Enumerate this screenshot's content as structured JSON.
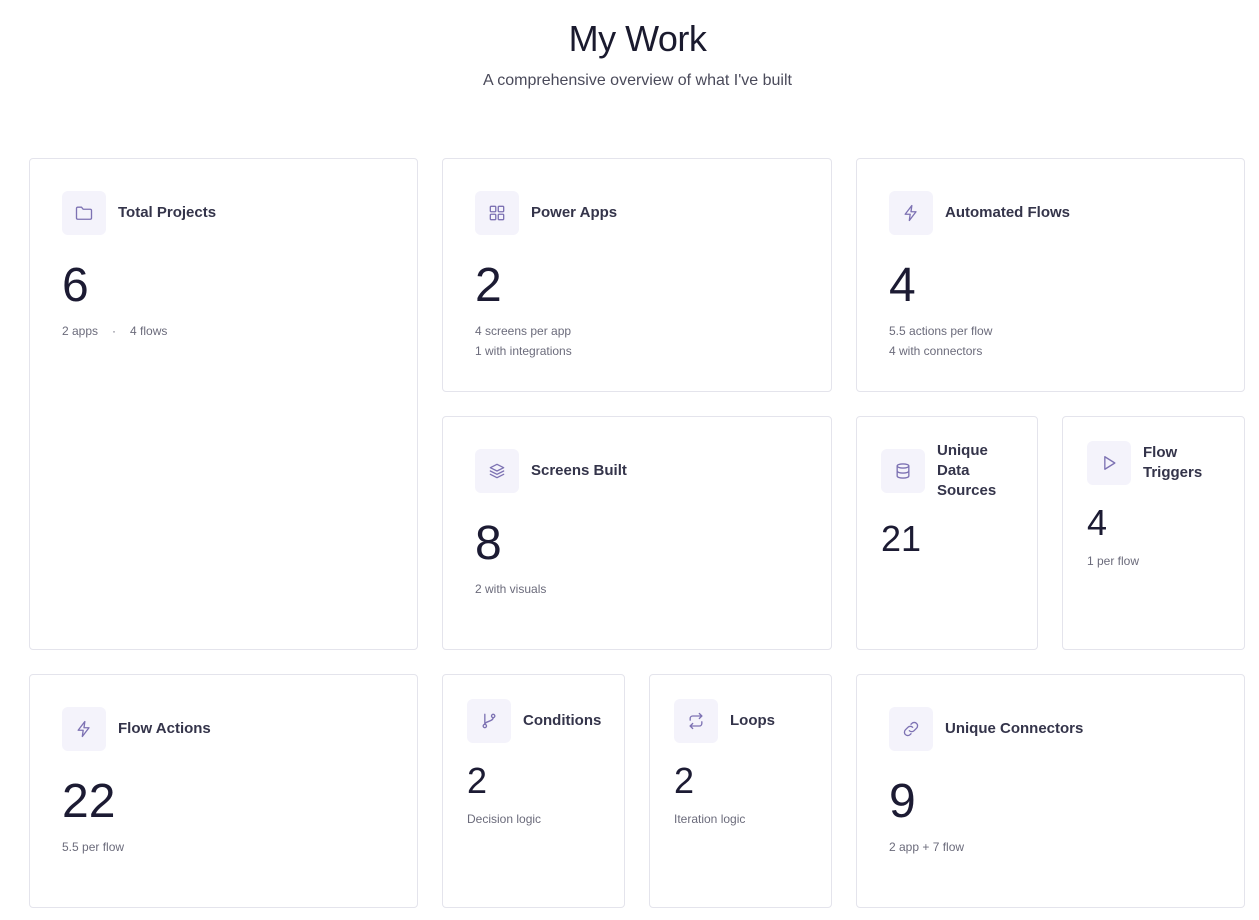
{
  "header": {
    "title": "My Work",
    "subtitle": "A comprehensive overview of what I've built"
  },
  "cards": {
    "total_projects": {
      "icon": "folder-icon",
      "title": "Total Projects",
      "value": "6",
      "detail_a": "2 apps",
      "separator": "·",
      "detail_b": "4 flows"
    },
    "power_apps": {
      "icon": "grid-icon",
      "title": "Power Apps",
      "value": "2",
      "line1": "4 screens per app",
      "line2": "1 with integrations"
    },
    "automated_flows": {
      "icon": "lightning-icon",
      "title": "Automated Flows",
      "value": "4",
      "line1": "5.5 actions per flow",
      "line2": "4 with connectors"
    },
    "screens_built": {
      "icon": "layers-icon",
      "title": "Screens Built",
      "value": "8",
      "line1": "2 with visuals"
    },
    "unique_data_sources": {
      "icon": "database-icon",
      "title_l1": "Unique",
      "title_l2": "Data",
      "title_l3": "Sources",
      "value": "21"
    },
    "flow_triggers": {
      "icon": "play-icon",
      "title_l1": "Flow",
      "title_l2": "Triggers",
      "value": "4",
      "line1": "1 per flow"
    },
    "flow_actions": {
      "icon": "lightning-icon",
      "title": "Flow Actions",
      "value": "22",
      "line1": "5.5 per flow"
    },
    "conditions": {
      "icon": "branch-icon",
      "title": "Conditions",
      "value": "2",
      "line1": "Decision logic"
    },
    "loops": {
      "icon": "repeat-icon",
      "title": "Loops",
      "value": "2",
      "line1": "Iteration logic"
    },
    "unique_connectors": {
      "icon": "link-icon",
      "title": "Unique Connectors",
      "value": "9",
      "line1": "2 app + 7 flow"
    }
  },
  "colors": {
    "icon_stroke": "#7d72b3",
    "icon_bg": "#f4f3fb",
    "border": "#e4e4ec"
  }
}
